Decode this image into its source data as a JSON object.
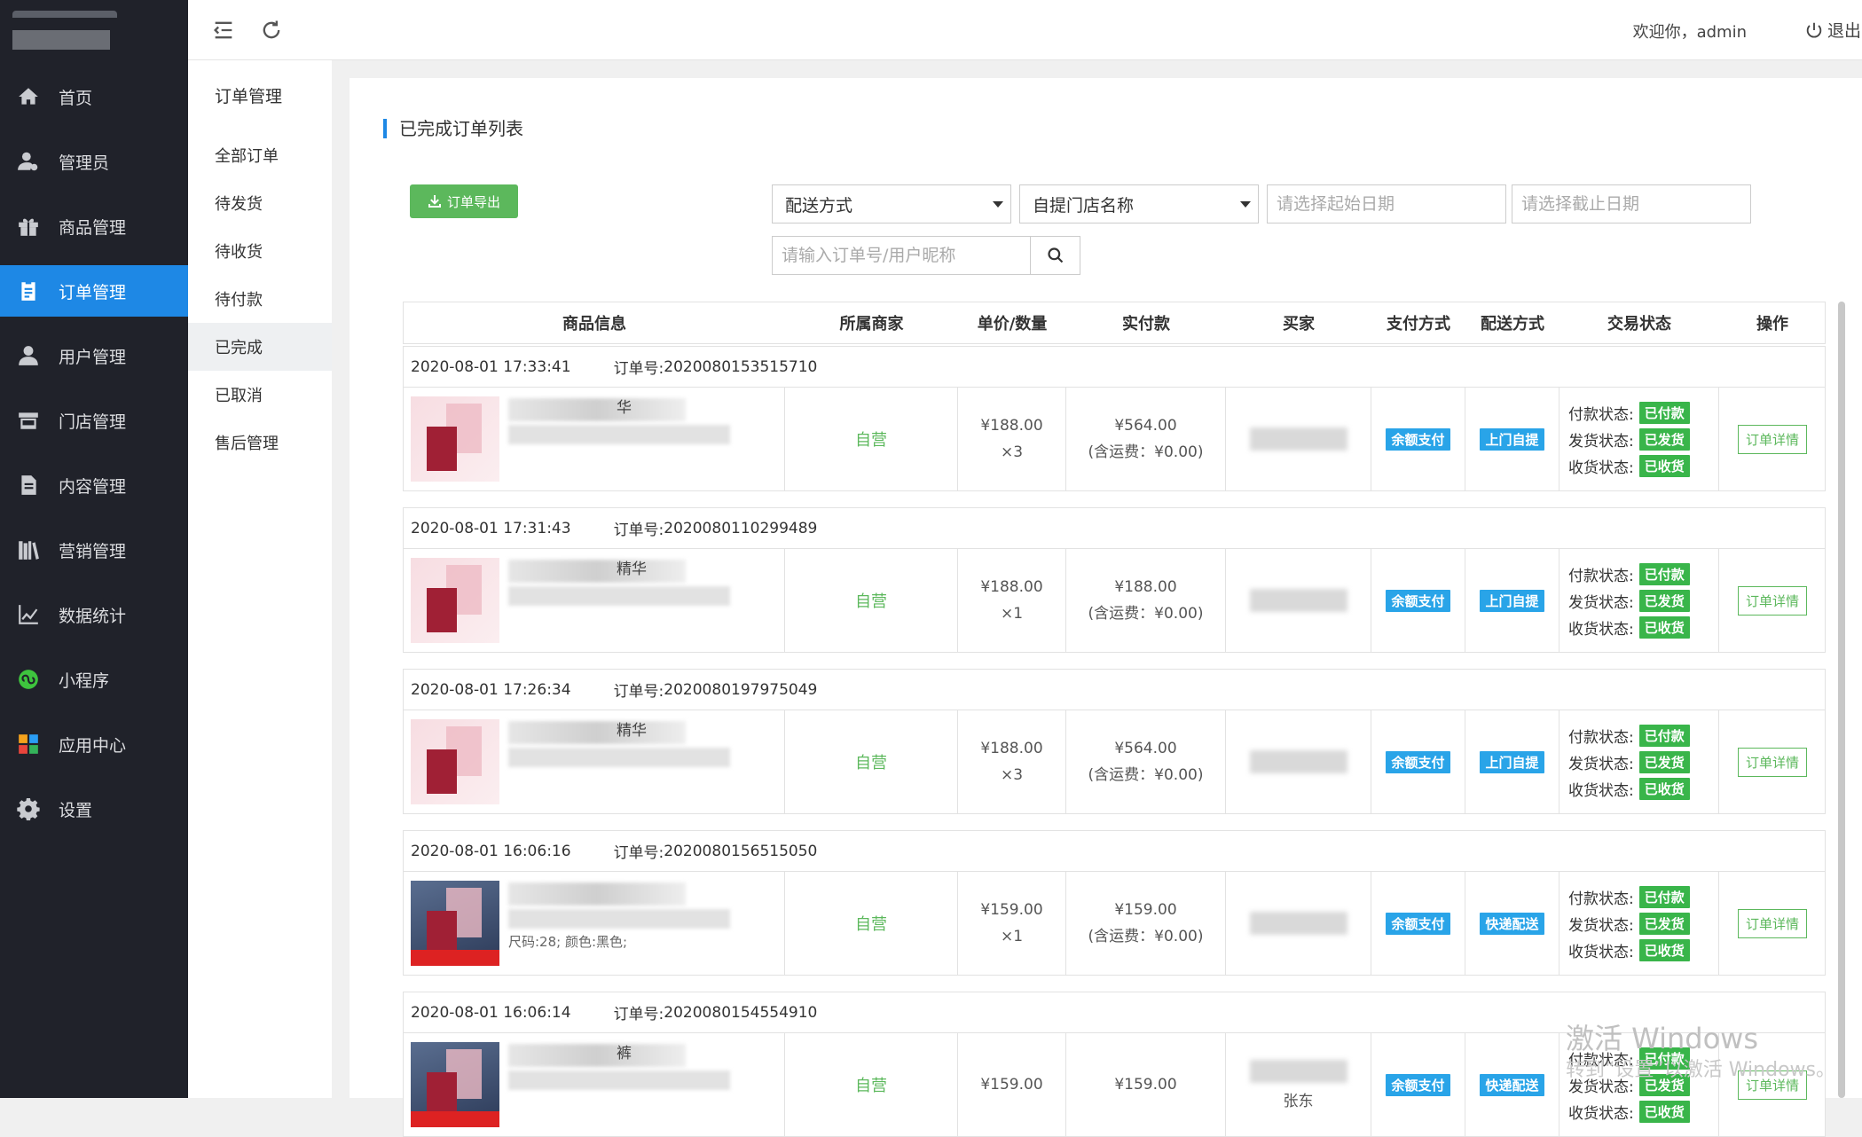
{
  "user": {
    "welcome": "欢迎你，admin",
    "logout": "退出"
  },
  "sidebar": {
    "items": [
      {
        "label": "首页",
        "icon": "home-icon"
      },
      {
        "label": "管理员",
        "icon": "admin-icon"
      },
      {
        "label": "商品管理",
        "icon": "gift-icon"
      },
      {
        "label": "订单管理",
        "icon": "clipboard-icon"
      },
      {
        "label": "用户管理",
        "icon": "user-icon"
      },
      {
        "label": "门店管理",
        "icon": "store-icon"
      },
      {
        "label": "内容管理",
        "icon": "document-icon"
      },
      {
        "label": "营销管理",
        "icon": "books-icon"
      },
      {
        "label": "数据统计",
        "icon": "line-chart-icon"
      },
      {
        "label": "小程序",
        "icon": "miniprogram-icon"
      },
      {
        "label": "应用中心",
        "icon": "apps-icon"
      },
      {
        "label": "设置",
        "icon": "gear-icon"
      }
    ],
    "active_index": 3
  },
  "submenu": {
    "title": "订单管理",
    "items": [
      "全部订单",
      "待发货",
      "待收货",
      "待付款",
      "已完成",
      "已取消",
      "售后管理"
    ],
    "active_index": 4
  },
  "panel": {
    "title": "已完成订单列表",
    "export_label": "订单导出",
    "filters": {
      "delivery_select": "配送方式",
      "store_select": "自提门店名称",
      "start_date_placeholder": "请选择起始日期",
      "end_date_placeholder": "请选择截止日期",
      "search_placeholder": "请输入订单号/用户昵称"
    }
  },
  "table": {
    "headers": [
      "商品信息",
      "所属商家",
      "单价/数量",
      "实付款",
      "买家",
      "支付方式",
      "配送方式",
      "交易状态",
      "操作"
    ],
    "status_labels": {
      "pay": "付款状态:",
      "ship": "发货状态:",
      "receive": "收货状态:"
    },
    "order_no_label": "订单号:",
    "orders": [
      {
        "time": "2020-08-01 17:33:41",
        "order_no": "2020080153515710",
        "goods_tail": "华",
        "spec": "",
        "merchant": "自营",
        "price": "¥188.00",
        "qty": "×3",
        "paid": "¥564.00",
        "shipping": "(含运费：¥0.00)",
        "buyer": "",
        "pay_method": "余额支付",
        "delivery": "上门自提",
        "pay_status": "已付款",
        "ship_status": "已发货",
        "recv_status": "已收货",
        "action": "订单详情",
        "img": "cosmetic"
      },
      {
        "time": "2020-08-01 17:31:43",
        "order_no": "2020080110299489",
        "goods_tail": "精华",
        "spec": "",
        "merchant": "自营",
        "price": "¥188.00",
        "qty": "×1",
        "paid": "¥188.00",
        "shipping": "(含运费：¥0.00)",
        "buyer": "",
        "pay_method": "余额支付",
        "delivery": "上门自提",
        "pay_status": "已付款",
        "ship_status": "已发货",
        "recv_status": "已收货",
        "action": "订单详情",
        "img": "cosmetic"
      },
      {
        "time": "2020-08-01 17:26:34",
        "order_no": "2020080197975049",
        "goods_tail": "精华",
        "spec": "",
        "merchant": "自营",
        "price": "¥188.00",
        "qty": "×3",
        "paid": "¥564.00",
        "shipping": "(含运费：¥0.00)",
        "buyer": "",
        "pay_method": "余额支付",
        "delivery": "上门自提",
        "pay_status": "已付款",
        "ship_status": "已发货",
        "recv_status": "已收货",
        "action": "订单详情",
        "img": "cosmetic"
      },
      {
        "time": "2020-08-01 16:06:16",
        "order_no": "2020080156515050",
        "goods_tail": "",
        "spec": "尺码:28; 颜色:黑色;",
        "merchant": "自营",
        "price": "¥159.00",
        "qty": "×1",
        "paid": "¥159.00",
        "shipping": "(含运费：¥0.00)",
        "buyer": "",
        "pay_method": "余额支付",
        "delivery": "快递配送",
        "pay_status": "已付款",
        "ship_status": "已发货",
        "recv_status": "已收货",
        "action": "订单详情",
        "img": "jeans"
      },
      {
        "time": "2020-08-01 16:06:14",
        "order_no": "2020080154554910",
        "goods_tail": "裤",
        "spec": "",
        "merchant": "自营",
        "price": "¥159.00",
        "qty": "",
        "paid": "¥159.00",
        "shipping": "",
        "buyer": "张东",
        "pay_method": "余额支付",
        "delivery": "快递配送",
        "pay_status": "已付款",
        "ship_status": "已发货",
        "recv_status": "已收货",
        "action": "订单详情",
        "img": "jeans"
      }
    ]
  },
  "watermark": {
    "line1": "激活 Windows",
    "line2": "转到“设置”以激活 Windows。"
  },
  "colors": {
    "sidebar_bg": "#20222a",
    "active_blue": "#1e88e5",
    "green": "#5cb85c",
    "tag_blue": "#29a4e8",
    "tag_green": "#39b54a"
  }
}
